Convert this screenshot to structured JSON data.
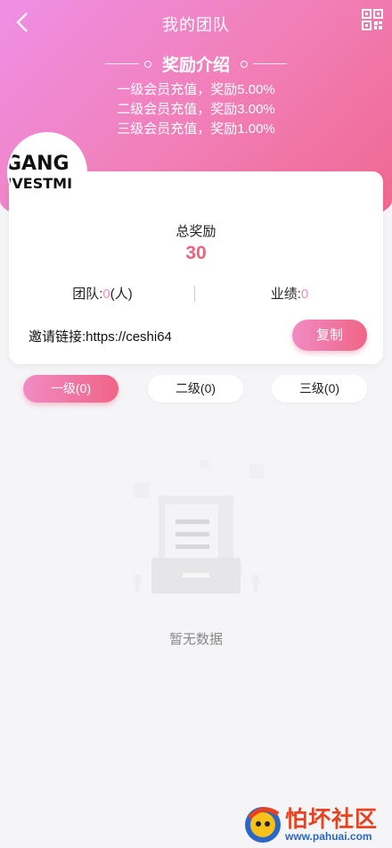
{
  "header": {
    "title": "我的团队",
    "back_icon": "chevron-left-icon",
    "qr_icon": "qr-code-icon"
  },
  "reward": {
    "title": "奖励介绍",
    "lines": [
      "一级会员充值，奖励5.00%",
      "二级会员充值，奖励3.00%",
      "三级会员充值，奖励1.00%"
    ]
  },
  "avatar": {
    "line1": "GANG",
    "line2": "NVESTMI"
  },
  "summary": {
    "total_label": "总奖励",
    "total_value": "30",
    "team_label": "团队:",
    "team_count": "0",
    "team_unit": "(人)",
    "perf_label": "业绩:",
    "perf_value": "0"
  },
  "invite": {
    "label": "邀请链接:",
    "link": "https://ceshi64",
    "copy_label": "复制"
  },
  "tabs": [
    {
      "label": "一级(0)",
      "active": true
    },
    {
      "label": "二级(0)",
      "active": false
    },
    {
      "label": "三级(0)",
      "active": false
    }
  ],
  "empty": {
    "text": "暂无数据"
  },
  "watermark": {
    "text": "怕坏社区",
    "url": "www.pahuai.com"
  },
  "colors": {
    "accent": "#f06486",
    "gradient_start": "#ef8fe6",
    "gradient_end": "#f0668e",
    "stat_value": "#e98fce"
  }
}
